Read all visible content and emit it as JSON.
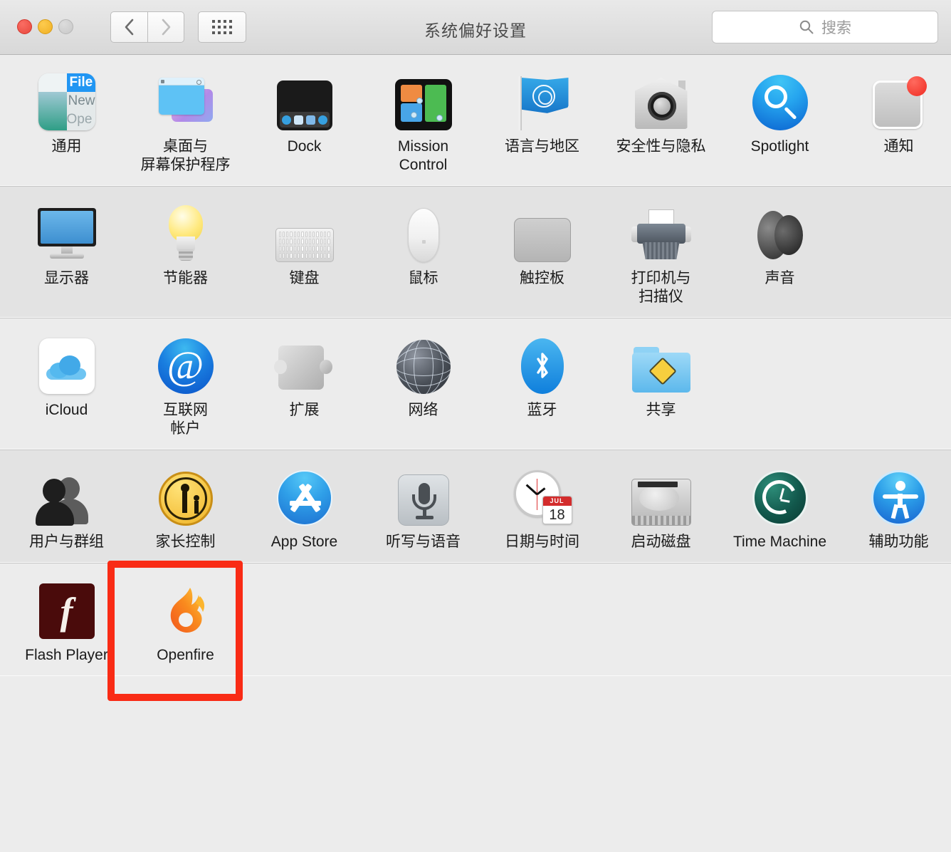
{
  "window": {
    "title": "系统偏好设置",
    "traffic_lights": [
      "close",
      "minimize",
      "zoom"
    ],
    "nav_back": "‹",
    "nav_forward": "›",
    "grid_button": "show-all"
  },
  "search": {
    "placeholder": "搜索",
    "value": "",
    "icon": "search-icon"
  },
  "sections": [
    {
      "id": "personal",
      "items": [
        {
          "icon": "general-icon",
          "label": "通用"
        },
        {
          "icon": "desktop-icon",
          "label": "桌面与\n屏幕保护程序"
        },
        {
          "icon": "dock-icon",
          "label": "Dock"
        },
        {
          "icon": "mission-control-icon",
          "label": "Mission\nControl"
        },
        {
          "icon": "language-region-icon",
          "label": "语言与地区"
        },
        {
          "icon": "security-icon",
          "label": "安全性与隐私"
        },
        {
          "icon": "spotlight-icon",
          "label": "Spotlight"
        },
        {
          "icon": "notifications-icon",
          "label": "通知"
        }
      ]
    },
    {
      "id": "hardware",
      "items": [
        {
          "icon": "display-icon",
          "label": "显示器"
        },
        {
          "icon": "energy-icon",
          "label": "节能器"
        },
        {
          "icon": "keyboard-icon",
          "label": "键盘"
        },
        {
          "icon": "mouse-icon",
          "label": "鼠标"
        },
        {
          "icon": "trackpad-icon",
          "label": "触控板"
        },
        {
          "icon": "printer-icon",
          "label": "打印机与\n扫描仪"
        },
        {
          "icon": "sound-icon",
          "label": "声音"
        }
      ]
    },
    {
      "id": "internet",
      "items": [
        {
          "icon": "icloud-icon",
          "label": "iCloud"
        },
        {
          "icon": "internet-accounts-icon",
          "label": "互联网\n帐户"
        },
        {
          "icon": "extensions-icon",
          "label": "扩展"
        },
        {
          "icon": "network-icon",
          "label": "网络"
        },
        {
          "icon": "bluetooth-icon",
          "label": "蓝牙"
        },
        {
          "icon": "sharing-icon",
          "label": "共享"
        }
      ]
    },
    {
      "id": "system",
      "items": [
        {
          "icon": "users-groups-icon",
          "label": "用户与群组"
        },
        {
          "icon": "parental-icon",
          "label": "家长控制"
        },
        {
          "icon": "app-store-icon",
          "label": "App Store"
        },
        {
          "icon": "dictation-icon",
          "label": "听写与语音"
        },
        {
          "icon": "date-time-icon",
          "label": "日期与时间"
        },
        {
          "icon": "startup-disk-icon",
          "label": "启动磁盘"
        },
        {
          "icon": "time-machine-icon",
          "label": "Time Machine"
        },
        {
          "icon": "accessibility-icon",
          "label": "辅助功能"
        }
      ]
    },
    {
      "id": "other",
      "items": [
        {
          "icon": "flash-player-icon",
          "label": "Flash Player"
        },
        {
          "icon": "openfire-icon",
          "label": "Openfire",
          "highlighted": true
        }
      ]
    }
  ],
  "date_time_icon": {
    "month": "JUL",
    "day": "18"
  },
  "general_icon_text": {
    "line1": "File",
    "line2": "New",
    "line3": "Ope"
  },
  "highlight": {
    "color": "#f92b15",
    "target": "Openfire"
  },
  "colors": {
    "titlebar_top": "#e9e9e9",
    "titlebar_bottom": "#d8d8d8",
    "content_light": "#ececec",
    "content_alt": "#e3e3e3",
    "divider": "#c6c6c6",
    "label_text": "#1a1a1a",
    "title_text": "#4a4a4a",
    "placeholder_text": "#9a9a9a",
    "highlight_red": "#f92b15"
  }
}
